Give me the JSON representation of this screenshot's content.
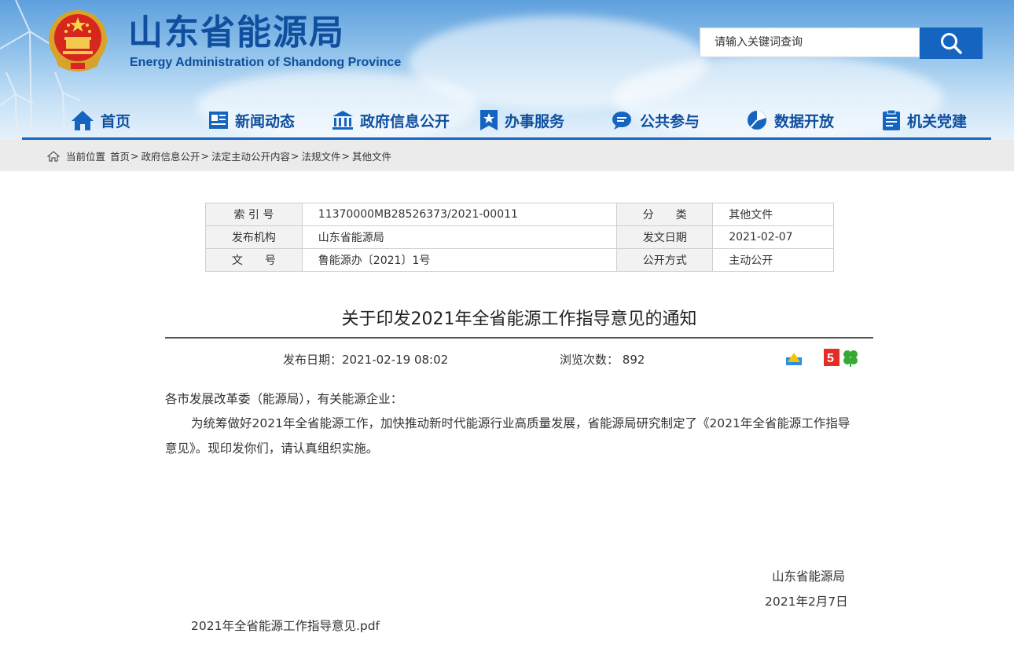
{
  "header": {
    "title": "山东省能源局",
    "subtitle": "Energy Administration of Shandong Province",
    "search_placeholder": "请输入关键词查询"
  },
  "nav": [
    {
      "label": "首页",
      "icon": "home-icon"
    },
    {
      "label": "新闻动态",
      "icon": "news-icon"
    },
    {
      "label": "政府信息公开",
      "icon": "government-icon"
    },
    {
      "label": "办事服务",
      "icon": "service-icon"
    },
    {
      "label": "公共参与",
      "icon": "chat-icon"
    },
    {
      "label": "数据开放",
      "icon": "pie-chart-icon"
    },
    {
      "label": "机关党建",
      "icon": "clipboard-icon"
    }
  ],
  "breadcrumb": {
    "prefix": "当前位置",
    "items": [
      "首页",
      "政府信息公开",
      "法定主动公开内容",
      "法规文件",
      "其他文件"
    ]
  },
  "meta": {
    "index_label": "索 引 号",
    "index_value": "11370000MB28526373/2021-00011",
    "category_label": "分　　类",
    "category_value": "其他文件",
    "publisher_label": "发布机构",
    "publisher_value": "山东省能源局",
    "issue_date_label": "发文日期",
    "issue_date_value": "2021-02-07",
    "doc_no_label": "文　　号",
    "doc_no_value": "鲁能源办〔2021〕1号",
    "open_mode_label": "公开方式",
    "open_mode_value": "主动公开"
  },
  "article": {
    "title": "关于印发2021年全省能源工作指导意见的通知",
    "publish_label": "发布日期：",
    "publish_value": "2021-02-19 08:02",
    "views_label": "浏览次数：",
    "views_value": "892",
    "greeting": "各市发展改革委（能源局），有关能源企业：",
    "body_line1": "为统筹做好2021年全省能源工作，加快推动新时代能源行业高质量发展，省能源局研究制定了《2021年全省能源工作指导",
    "body_line2": "意见》。现印发你们，请认真组织实施。",
    "signature": "山东省能源局",
    "sign_date": "2021年2月7日",
    "attachment": "2021年全省能源工作指导意见.pdf"
  },
  "colors": {
    "brand_blue": "#0f4f9e",
    "accent_blue": "#1565c0"
  }
}
